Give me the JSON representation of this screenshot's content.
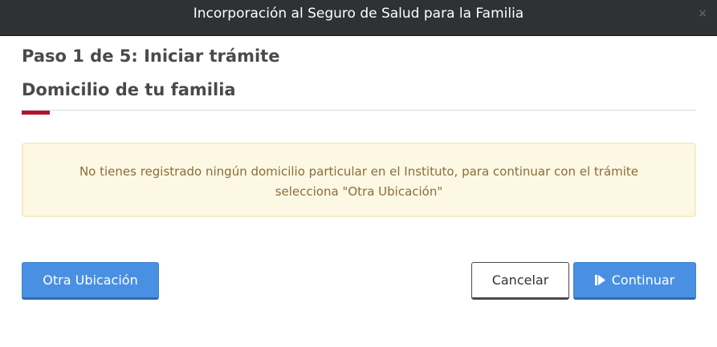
{
  "dialog": {
    "title": "Incorporación al Seguro de Salud para la Familia",
    "close_glyph": "×"
  },
  "step": {
    "title": "Paso 1 de 5: Iniciar trámite"
  },
  "section": {
    "title": "Domicilio de tu familia"
  },
  "alert": {
    "message": "No tienes registrado ningún domicilio particular en el Instituto, para continuar con el trámite selecciona \"Otra Ubicación\""
  },
  "buttons": {
    "other_location": "Otra Ubicación",
    "cancel": "Cancelar",
    "continue": "Continuar",
    "continue_icon": "step-forward-icon"
  },
  "colors": {
    "titlebar": "#2f3133",
    "accent": "#b3142d",
    "primary": "#4a90e2",
    "alert_bg": "#fcf8e3",
    "alert_text": "#8a6d3b"
  }
}
